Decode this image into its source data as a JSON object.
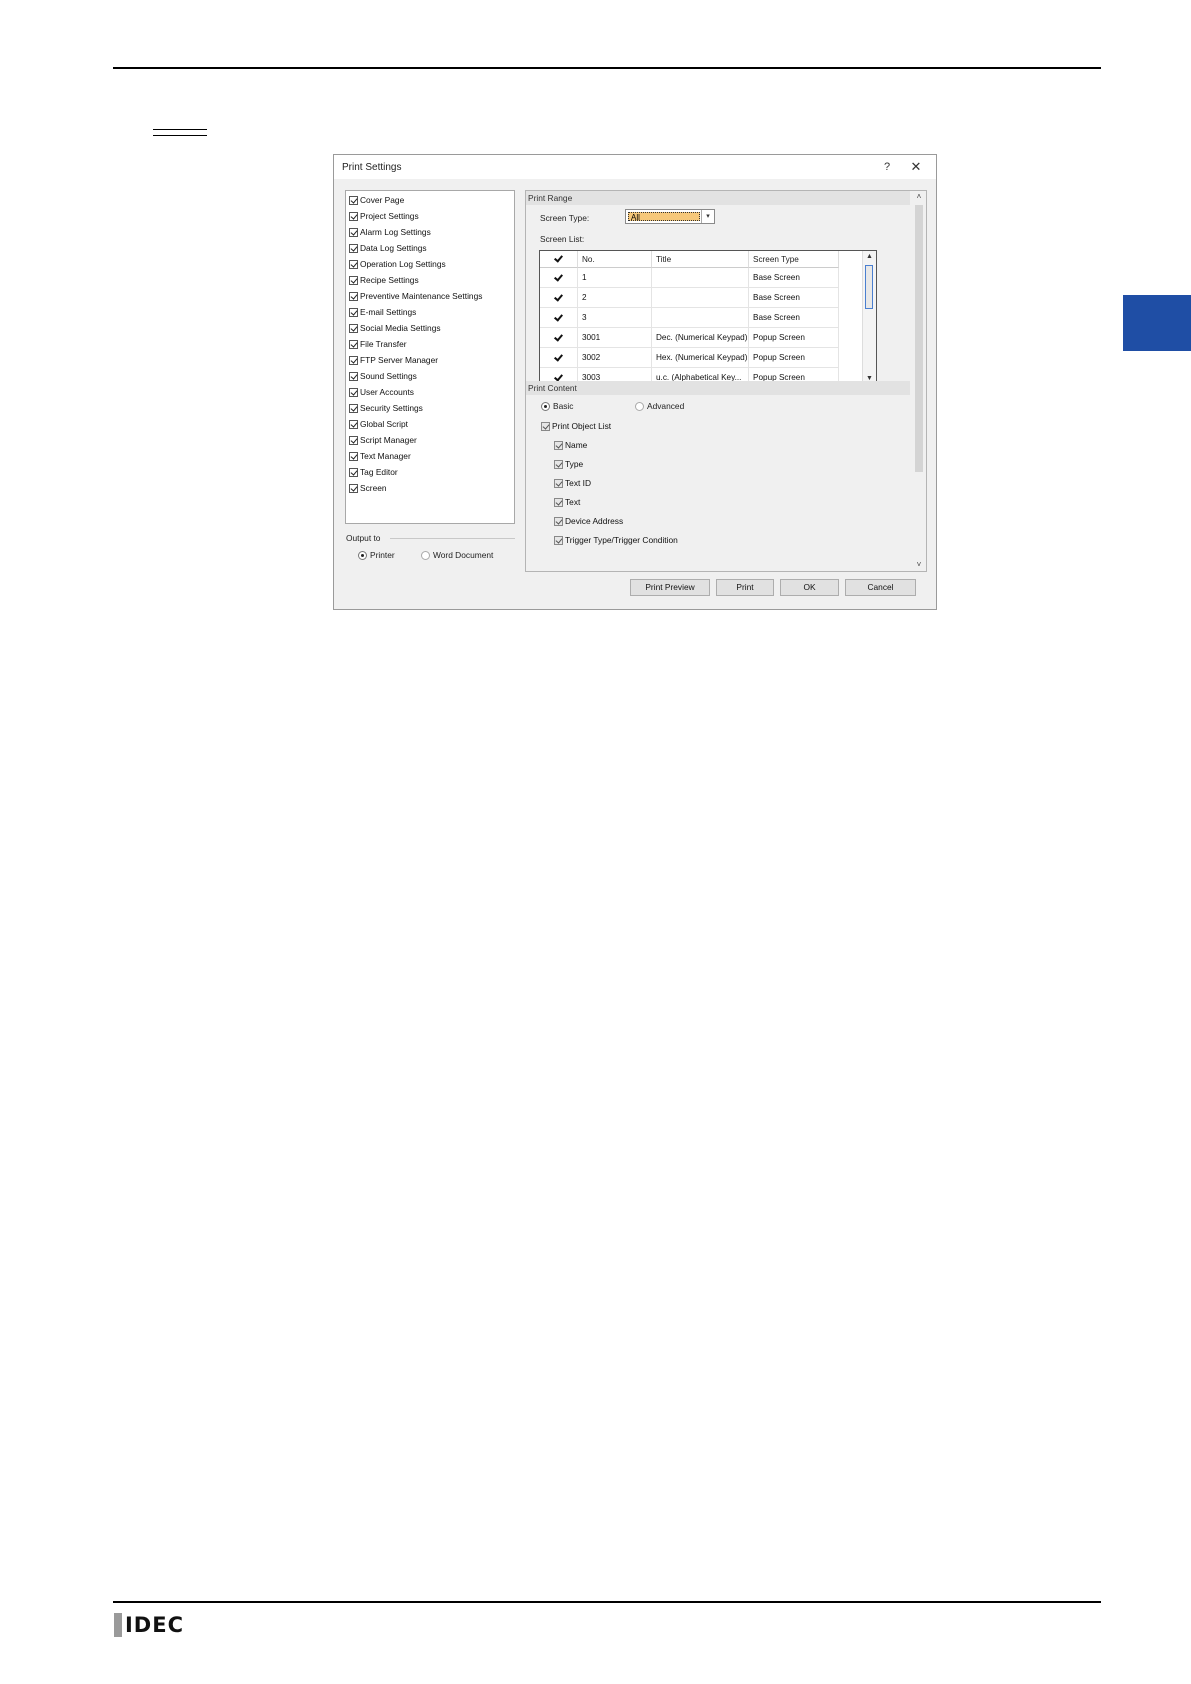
{
  "dialog": {
    "title": "Print Settings",
    "help": "?",
    "close": "✕",
    "left_items": [
      {
        "label": "Cover Page",
        "checked": true
      },
      {
        "label": "Project Settings",
        "checked": true
      },
      {
        "label": "Alarm Log Settings",
        "checked": true
      },
      {
        "label": "Data Log Settings",
        "checked": true
      },
      {
        "label": "Operation Log Settings",
        "checked": true
      },
      {
        "label": "Recipe Settings",
        "checked": true
      },
      {
        "label": "Preventive Maintenance Settings",
        "checked": true
      },
      {
        "label": "E-mail Settings",
        "checked": true
      },
      {
        "label": "Social Media Settings",
        "checked": true
      },
      {
        "label": "File Transfer",
        "checked": true
      },
      {
        "label": "FTP Server Manager",
        "checked": true
      },
      {
        "label": "Sound Settings",
        "checked": true
      },
      {
        "label": "User Accounts",
        "checked": true
      },
      {
        "label": "Security Settings",
        "checked": true
      },
      {
        "label": "Global Script",
        "checked": true
      },
      {
        "label": "Script Manager",
        "checked": true
      },
      {
        "label": "Text Manager",
        "checked": true
      },
      {
        "label": "Tag Editor",
        "checked": true
      },
      {
        "label": "Screen",
        "checked": true
      }
    ],
    "output": {
      "label": "Output to",
      "printer": "Printer",
      "word": "Word Document",
      "selected": "Printer"
    },
    "print_range": {
      "header": "Print Range",
      "screen_type_label": "Screen Type:",
      "screen_type_value": "All",
      "screen_list_label": "Screen List:",
      "columns": [
        "No.",
        "Title",
        "Screen Type"
      ],
      "rows": [
        {
          "checked": true,
          "no": "1",
          "title": "",
          "type": "Base Screen"
        },
        {
          "checked": true,
          "no": "2",
          "title": "",
          "type": "Base Screen"
        },
        {
          "checked": true,
          "no": "3",
          "title": "",
          "type": "Base Screen"
        },
        {
          "checked": true,
          "no": "3001",
          "title": "Dec. (Numerical Keypad)",
          "type": "Popup Screen"
        },
        {
          "checked": true,
          "no": "3002",
          "title": "Hex. (Numerical Keypad)",
          "type": "Popup Screen"
        },
        {
          "checked": true,
          "no": "3003",
          "title": "u.c. (Alphabetical Key...",
          "type": "Popup Screen"
        }
      ]
    },
    "print_content": {
      "header": "Print Content",
      "basic": "Basic",
      "advanced": "Advanced",
      "selected": "Basic",
      "object_list": "Print Object List",
      "items": [
        "Name",
        "Type",
        "Text ID",
        "Text",
        "Device Address",
        "Trigger Type/Trigger Condition"
      ]
    },
    "buttons": {
      "preview": "Print Preview",
      "print": "Print",
      "ok": "OK",
      "cancel": "Cancel"
    }
  },
  "footer": {
    "logo": "IDEC"
  }
}
